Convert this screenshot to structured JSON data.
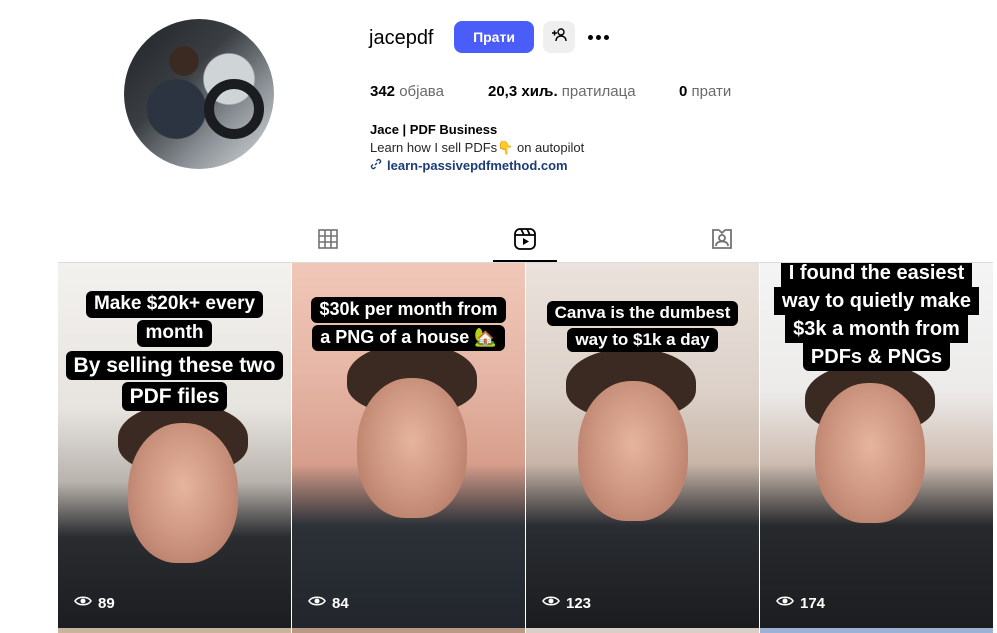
{
  "profile": {
    "username": "jacepdf",
    "follow_label": "Прати",
    "stats": {
      "posts_count": "342",
      "posts_label": "објава",
      "followers_count": "20,3 хиљ.",
      "followers_label": "пратилаца",
      "following_count": "0",
      "following_label": "прати"
    },
    "bio_name": "Jace | PDF Business",
    "bio_text": "Learn how I sell PDFs👇 on autopilot",
    "bio_link": "learn-passivepdfmethod.com"
  },
  "tabs": [
    {
      "icon": "grid-icon",
      "active": false
    },
    {
      "icon": "reels-icon",
      "active": true
    },
    {
      "icon": "tagged-icon",
      "active": false
    }
  ],
  "reels": [
    {
      "caption_top": [
        "Make $20k+ every",
        "month"
      ],
      "caption_bottom": [
        "By selling these two",
        "PDF files"
      ],
      "views": "89"
    },
    {
      "caption_top": [
        "$30k per month from",
        "a PNG of a house 🏡"
      ],
      "caption_bottom": [],
      "views": "84"
    },
    {
      "caption_top": [
        "Canva is the dumbest",
        "way to $1k a day"
      ],
      "caption_bottom": [],
      "views": "123"
    },
    {
      "caption_top": [
        "I found the easiest",
        "way to quietly make",
        "$3k a month from",
        "PDFs & PNGs"
      ],
      "caption_bottom": [],
      "views": "174"
    }
  ],
  "colors": {
    "accent": "#4a5df9",
    "link": "#1c3c78",
    "muted": "#6a6a6a"
  }
}
